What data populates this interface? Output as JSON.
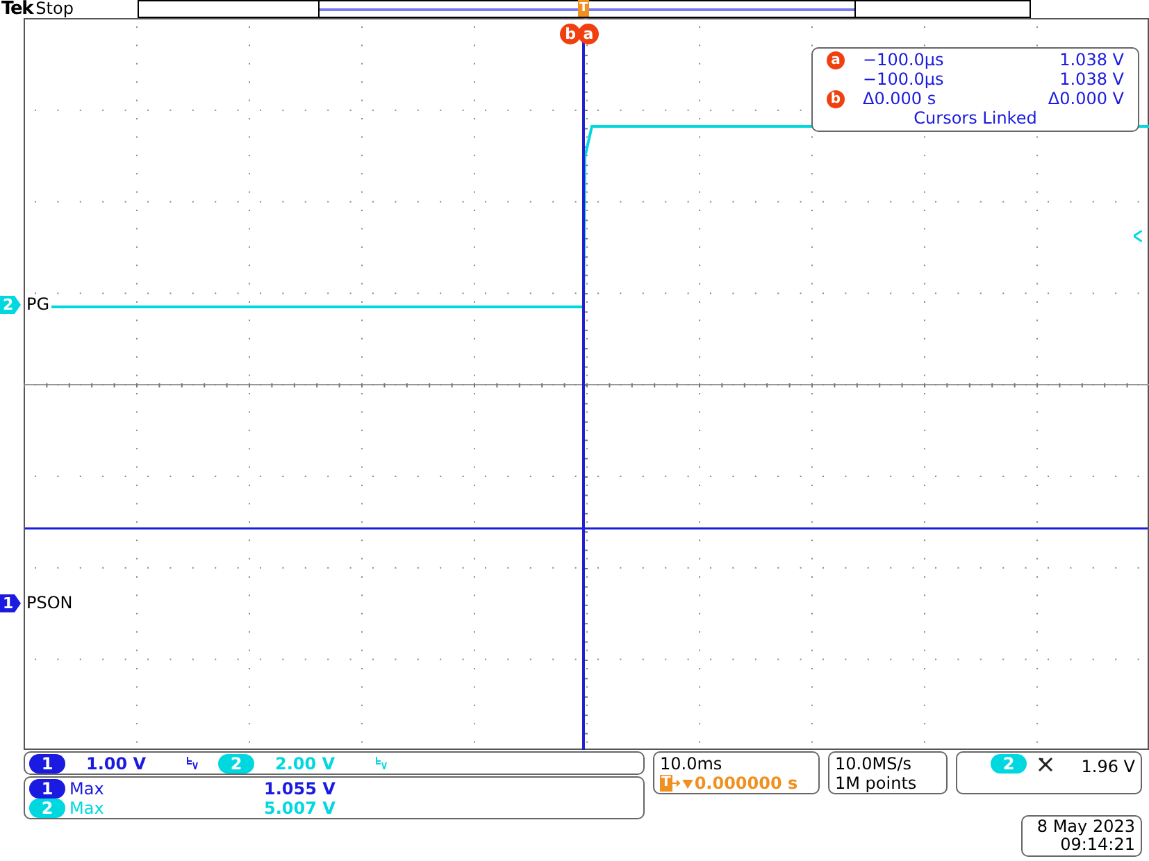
{
  "header": {
    "brand": "Tek",
    "status": "Stop"
  },
  "trigger_marker": "T",
  "cursor_markers": [
    {
      "label": "b"
    },
    {
      "label": "a"
    }
  ],
  "cursor_readout": {
    "rows": [
      {
        "marker": "a",
        "time": "−100.0µs",
        "value": "1.038 V"
      },
      {
        "time": "−100.0µs",
        "value": "1.038 V"
      },
      {
        "marker": "b",
        "time": "Δ0.000 s",
        "value": "Δ0.000 V"
      }
    ],
    "footer": "Cursors Linked"
  },
  "channels": [
    {
      "number": "2",
      "label": "PG",
      "color": "#00d8e0"
    },
    {
      "number": "1",
      "label": "PSON",
      "color": "#1a1ae0"
    }
  ],
  "vertical": [
    {
      "number": "1",
      "scale": "1.00 V",
      "color": "#1a1ae0"
    },
    {
      "number": "2",
      "scale": "2.00 V",
      "color": "#00d8e0"
    }
  ],
  "measurements": [
    {
      "number": "1",
      "name": "Max",
      "value": "1.055 V",
      "color": "#1a1ae0"
    },
    {
      "number": "2",
      "name": "Max",
      "value": "5.007 V",
      "color": "#00d8e0"
    }
  ],
  "timebase": {
    "scale": "10.0ms",
    "trigger_icon": "T",
    "trigger_position": "0.000000 s"
  },
  "acquisition": {
    "sample_rate": "10.0MS/s",
    "record_length": "1M points"
  },
  "trigger": {
    "number": "2",
    "level": "1.96 V",
    "color": "#00d8e0"
  },
  "datetime": {
    "date": "8 May 2023",
    "time": "09:14:21"
  }
}
